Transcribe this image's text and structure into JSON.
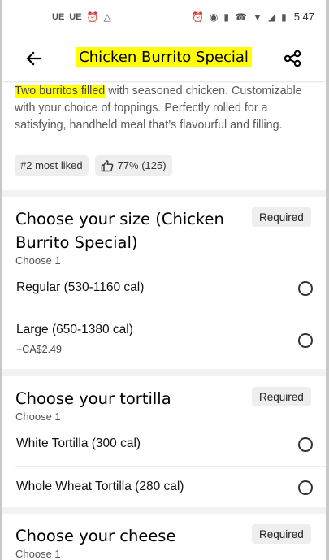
{
  "status_bar": {
    "left_icons": [
      "UE",
      "UE"
    ],
    "time": "5:47"
  },
  "header": {
    "title": "Chicken Burrito Special"
  },
  "description": {
    "highlighted": "Two burritos filled",
    "rest": " with seasoned chicken. Customizable with your choice of toppings. Perfectly rolled for a satisfying, handheld meal that’s flavourful and filling."
  },
  "chips": {
    "rank": "#2 most liked",
    "likes": "77% (125)"
  },
  "sections": [
    {
      "title": "Choose your size (Chicken Burrito Special)",
      "badge": "Required",
      "sub": "Choose 1",
      "options": [
        {
          "label": "Regular (530-1160 cal)",
          "price": ""
        },
        {
          "label": "Large (650-1380 cal)",
          "price": "+CA$2.49"
        }
      ]
    },
    {
      "title": "Choose your tortilla",
      "badge": "Required",
      "sub": "Choose 1",
      "options": [
        {
          "label": "White Tortilla (300 cal)",
          "price": ""
        },
        {
          "label": "Whole Wheat Tortilla (280 cal)",
          "price": ""
        }
      ]
    },
    {
      "title": "Choose your cheese",
      "badge": "Required",
      "sub": "Choose 1",
      "options": []
    }
  ],
  "icons": {
    "back": "arrow-left",
    "share": "share-nodes",
    "like": "thumbs-up",
    "option_control": "radio-circle"
  }
}
